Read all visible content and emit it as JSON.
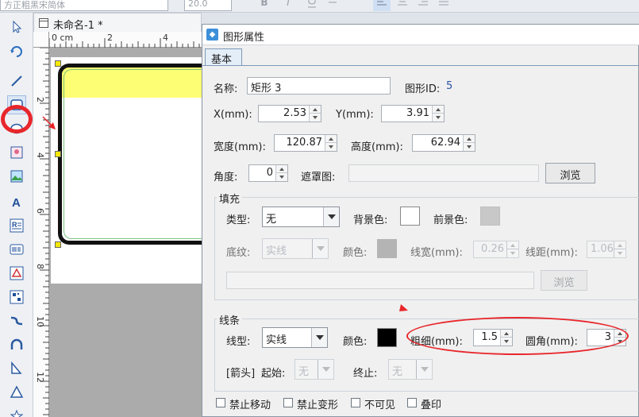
{
  "toolbar": {
    "font_value": "方正粗黑宋简体",
    "size_value": "20.0",
    "bold_glyph": "B",
    "italic_glyph": "I"
  },
  "document": {
    "tab_title": "未命名-1 *",
    "ruler_h_labels": [
      "0 cm",
      "2",
      "4"
    ],
    "ruler_v_labels": [
      "2",
      "4",
      "6",
      "8",
      "10",
      "12"
    ]
  },
  "dialog": {
    "title": "图形属性",
    "tabs": [
      {
        "label": "基本"
      }
    ],
    "name_label": "名称:",
    "name_value": "矩形 3",
    "shape_id_label": "图形ID:",
    "shape_id_value": "5",
    "x_label": "X(mm):",
    "x_value": "2.53",
    "y_label": "Y(mm):",
    "y_value": "3.91",
    "width_label": "宽度(mm):",
    "width_value": "120.87",
    "height_label": "高度(mm):",
    "height_value": "62.94",
    "angle_label": "角度:",
    "angle_value": "0",
    "mask_label": "遮罩图:",
    "mask_value": "",
    "browse_label": "浏览",
    "fill": {
      "group_label": "填充",
      "type_label": "类型:",
      "type_value": "无",
      "bg_label": "背景色:",
      "bg_color": "#ffffff",
      "fg_label": "前景色:",
      "fg_color": "#c8c8c8",
      "pattern_label": "底纹:",
      "pattern_value": "实线",
      "color_label": "颜色:",
      "color_value": "#b4b4b4",
      "line_width_label": "线宽(mm):",
      "line_width_value": "0.26",
      "line_gap_label": "线距(mm):",
      "line_gap_value": "1.06",
      "image_path": "",
      "browse_label": "浏览"
    },
    "line": {
      "group_label": "线条",
      "type_label": "线型:",
      "type_value": "实线",
      "color_label": "颜色:",
      "color_value": "#000000",
      "thickness_label": "粗细(mm):",
      "thickness_value": "1.5",
      "corner_label": "圆角(mm):",
      "corner_value": "3",
      "arrow_label": "[箭头]",
      "start_label": "起始:",
      "start_value": "无",
      "end_label": "终止:",
      "end_value": "无"
    },
    "checkboxes": [
      {
        "label": "禁止移动"
      },
      {
        "label": "禁止变形"
      },
      {
        "label": "不可见"
      },
      {
        "label": "叠印"
      }
    ]
  },
  "colors": {
    "annotation_red": "#e8262b",
    "fill_yellow": "#fefe74",
    "accent_blue": "#3d8fd9"
  }
}
